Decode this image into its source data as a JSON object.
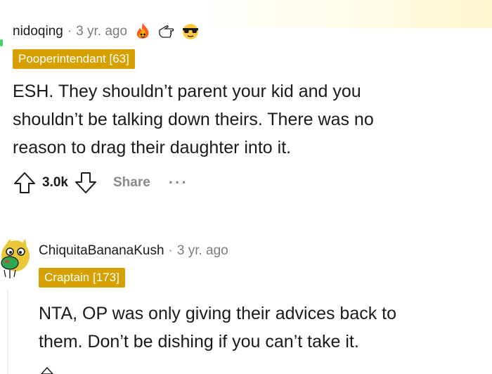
{
  "comments": [
    {
      "username": "nidoqing",
      "separator": "·",
      "time": "3 yr. ago",
      "awards": [
        "fire-award-icon",
        "pointing-hand-award-icon",
        "sunglasses-award-icon"
      ],
      "flair": "Pooperintendant [63]",
      "flair_color": "#d6a000",
      "body_lines": [
        "ESH. They shouldn’t parent your kid and you",
        "shouldn’t be talking down theirs. There was no",
        "reason to drag their daughter into it."
      ],
      "vote_count": "3.0k",
      "share_label": "Share",
      "more_label": "···"
    },
    {
      "username": "ChiquitaBananaKush",
      "separator": "·",
      "time": "3 yr. ago",
      "flair": "Craptain [173]",
      "flair_color": "#d6a000",
      "body_lines": [
        "NTA, OP was only giving their advices back to",
        "them. Don’t be dishing if you can’t take it."
      ]
    }
  ]
}
